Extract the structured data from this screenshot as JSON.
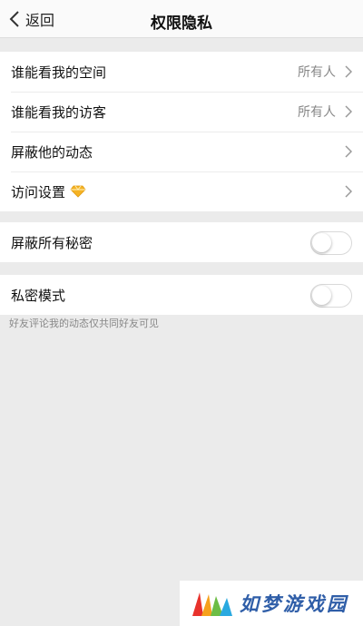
{
  "nav": {
    "back_label": "返回",
    "title": "权限隐私"
  },
  "group1": {
    "rows": [
      {
        "label": "谁能看我的空间",
        "value": "所有人"
      },
      {
        "label": "谁能看我的访客",
        "value": "所有人"
      },
      {
        "label": "屏蔽他的动态"
      },
      {
        "label": "访问设置",
        "badge_icon": "diamond-icon"
      }
    ]
  },
  "group2": {
    "label": "屏蔽所有秘密",
    "toggle_on": false
  },
  "group3": {
    "label": "私密模式",
    "toggle_on": false
  },
  "note": "好友评论我的动态仅共同好友可见",
  "watermark": {
    "text": "如梦游戏园"
  },
  "colors": {
    "background": "#ebebeb",
    "accent_diamond": "#f5b324",
    "brand_blue": "#2f5ea8"
  }
}
